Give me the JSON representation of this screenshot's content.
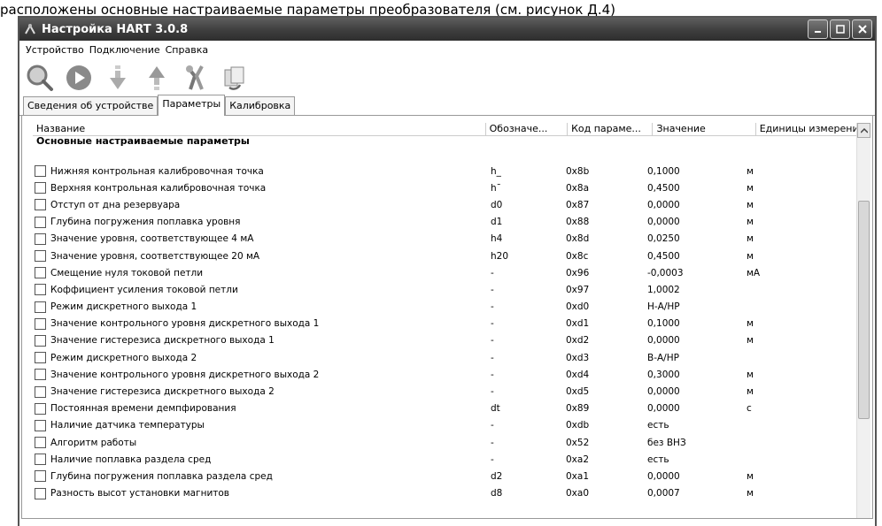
{
  "doc_top_text": "расположены основные настраиваемые параметры преобразователя (см. рисунок Д.4)",
  "window": {
    "title": "Настройка HART 3.0.8"
  },
  "menu": [
    {
      "label": "Устройство"
    },
    {
      "label": "Подключение"
    },
    {
      "label": "Справка"
    }
  ],
  "toolbar": [
    {
      "icon": "search-icon"
    },
    {
      "icon": "play-icon"
    },
    {
      "icon": "download-arrow-icon"
    },
    {
      "icon": "upload-arrow-icon"
    },
    {
      "icon": "tools-icon"
    },
    {
      "icon": "refresh-icon"
    }
  ],
  "tabs": [
    {
      "label": "Сведения об устройстве"
    },
    {
      "label": "Параметры"
    },
    {
      "label": "Калибровка"
    }
  ],
  "columns": [
    "Название",
    "Обозначе...",
    "Код параме...",
    "Значение",
    "Единицы измерени"
  ],
  "group_title": "Основные настраиваемые параметры",
  "rows": [
    {
      "name": "Нижняя контрольная калибровочная точка",
      "sym": "h_",
      "code": "0x8b",
      "value": "0,1000",
      "unit": "м"
    },
    {
      "name": "Верхняя контрольная калибровочная точка",
      "sym": "h¯",
      "code": "0x8a",
      "value": "0,4500",
      "unit": "м"
    },
    {
      "name": "Отступ от дна резервуара",
      "sym": "d0",
      "code": "0x87",
      "value": "0,0000",
      "unit": "м"
    },
    {
      "name": "Глубина погружения поплавка уровня",
      "sym": "d1",
      "code": "0x88",
      "value": "0,0000",
      "unit": "м"
    },
    {
      "name": "Значение уровня, соответствующее 4 мА",
      "sym": "h4",
      "code": "0x8d",
      "value": "0,0250",
      "unit": "м"
    },
    {
      "name": "Значение уровня, соответствующее 20 мА",
      "sym": "h20",
      "code": "0x8c",
      "value": "0,4500",
      "unit": "м"
    },
    {
      "name": "Смещение нуля токовой петли",
      "sym": "-",
      "code": "0x96",
      "value": "-0,0003",
      "unit": "мА"
    },
    {
      "name": "Коффициент усиления токовой петли",
      "sym": "-",
      "code": "0x97",
      "value": "1,0002",
      "unit": ""
    },
    {
      "name": "Режим дискретного выхода 1",
      "sym": "-",
      "code": "0xd0",
      "value": "Н-А/НР",
      "unit": ""
    },
    {
      "name": "Значение контрольного уровня дискретного выхода 1",
      "sym": "-",
      "code": "0xd1",
      "value": "0,1000",
      "unit": "м"
    },
    {
      "name": "Значение гистерезиса дискретного выхода 1",
      "sym": "-",
      "code": "0xd2",
      "value": "0,0000",
      "unit": "м"
    },
    {
      "name": "Режим дискретного выхода 2",
      "sym": "-",
      "code": "0xd3",
      "value": "В-А/НР",
      "unit": ""
    },
    {
      "name": "Значение контрольного уровня дискретного выхода 2",
      "sym": "-",
      "code": "0xd4",
      "value": "0,3000",
      "unit": "м"
    },
    {
      "name": "Значение гистерезиса дискретного выхода 2",
      "sym": "-",
      "code": "0xd5",
      "value": "0,0000",
      "unit": "м"
    },
    {
      "name": "Постоянная времени демпфирования",
      "sym": "dt",
      "code": "0x89",
      "value": "0,0000",
      "unit": "с"
    },
    {
      "name": "Наличие датчика температуры",
      "sym": "-",
      "code": "0xdb",
      "value": "есть",
      "unit": ""
    },
    {
      "name": "Алгоритм работы",
      "sym": "-",
      "code": "0x52",
      "value": "без ВНЗ",
      "unit": ""
    },
    {
      "name": "Наличие поплавка раздела сред",
      "sym": "-",
      "code": "0xa2",
      "value": "есть",
      "unit": ""
    },
    {
      "name": "Глубина погружения поплавка раздела сред",
      "sym": "d2",
      "code": "0xa1",
      "value": "0,0000",
      "unit": "м"
    },
    {
      "name": "Разность высот установки магнитов",
      "sym": "d8",
      "code": "0xa0",
      "value": "0,0007",
      "unit": "м"
    }
  ]
}
